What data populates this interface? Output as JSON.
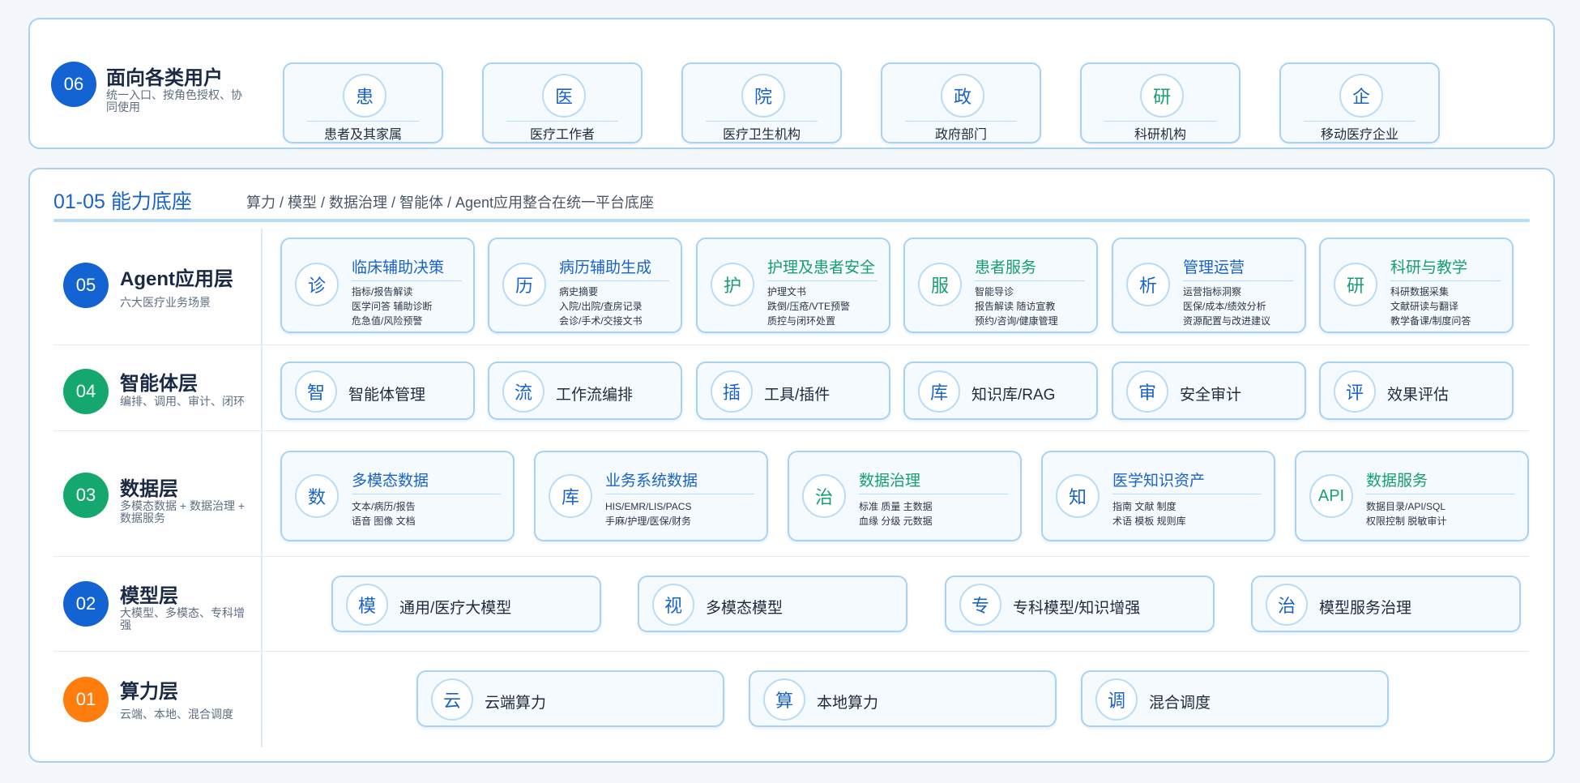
{
  "colors": {
    "blue_badge": "#1463d2",
    "green_badge": "#14a86e",
    "orange_badge": "#ff7d0d",
    "accent": "#1a63c8",
    "accent_green": "#16a070"
  },
  "users": {
    "badge": "06",
    "title": "面向各类用户",
    "subtitle": "统一入口、按角色授权、协同使用",
    "items": [
      {
        "icon": "患",
        "label": "患者及其家属",
        "tone": "blue"
      },
      {
        "icon": "医",
        "label": "医疗工作者",
        "tone": "blue"
      },
      {
        "icon": "院",
        "label": "医疗卫生机构",
        "tone": "blue"
      },
      {
        "icon": "政",
        "label": "政府部门",
        "tone": "blue"
      },
      {
        "icon": "研",
        "label": "科研机构",
        "tone": "green"
      },
      {
        "icon": "企",
        "label": "移动医疗企业",
        "tone": "blue"
      }
    ]
  },
  "platform": {
    "title": "01-05 能力底座",
    "subtitle": "算力 / 模型 / 数据治理 / 智能体 / Agent应用整合在统一平台底座"
  },
  "layers": {
    "l05": {
      "badge": "05",
      "title": "Agent应用层",
      "subtitle": "六大医疗业务场景",
      "cards": [
        {
          "icon": "诊",
          "title": "临床辅助决策",
          "tone": "blue",
          "lines": [
            "指标/报告解读",
            "医学问答 辅助诊断",
            "危急值/风险预警"
          ]
        },
        {
          "icon": "历",
          "title": "病历辅助生成",
          "tone": "blue",
          "lines": [
            "病史摘要",
            "入院/出院/查房记录",
            "会诊/手术/交接文书"
          ]
        },
        {
          "icon": "护",
          "title": "护理及患者安全",
          "tone": "green",
          "lines": [
            "护理文书",
            "跌倒/压疮/VTE预警",
            "质控与闭环处置"
          ]
        },
        {
          "icon": "服",
          "title": "患者服务",
          "tone": "green",
          "lines": [
            "智能导诊",
            "报告解读 随访宣教",
            "预约/咨询/健康管理"
          ]
        },
        {
          "icon": "析",
          "title": "管理运营",
          "tone": "blue",
          "lines": [
            "运营指标洞察",
            "医保/成本/绩效分析",
            "资源配置与改进建议"
          ]
        },
        {
          "icon": "研",
          "title": "科研与教学",
          "tone": "green",
          "lines": [
            "科研数据采集",
            "文献研读与翻译",
            "教学备课/制度问答"
          ]
        }
      ]
    },
    "l04": {
      "badge": "04",
      "title": "智能体层",
      "subtitle": "编排、调用、审计、闭环",
      "cards": [
        {
          "icon": "智",
          "label": "智能体管理"
        },
        {
          "icon": "流",
          "label": "工作流编排"
        },
        {
          "icon": "插",
          "label": "工具/插件"
        },
        {
          "icon": "库",
          "label": "知识库/RAG"
        },
        {
          "icon": "审",
          "label": "安全审计"
        },
        {
          "icon": "评",
          "label": "效果评估"
        }
      ]
    },
    "l03": {
      "badge": "03",
      "title": "数据层",
      "subtitle": "多模态数据 + 数据治理 + 数据服务",
      "cards": [
        {
          "icon": "数",
          "title": "多模态数据",
          "tone": "blue",
          "lines": [
            "文本/病历/报告",
            "语音 图像 文档"
          ]
        },
        {
          "icon": "库",
          "title": "业务系统数据",
          "tone": "blue",
          "lines": [
            "HIS/EMR/LIS/PACS",
            "手麻/护理/医保/财务"
          ]
        },
        {
          "icon": "治",
          "title": "数据治理",
          "tone": "green",
          "lines": [
            "标准 质量 主数据",
            "血缘 分级 元数据"
          ]
        },
        {
          "icon": "知",
          "title": "医学知识资产",
          "tone": "blue",
          "lines": [
            "指南 文献 制度",
            "术语 模板 规则库"
          ]
        },
        {
          "icon": "API",
          "title": "数据服务",
          "tone": "green",
          "lines": [
            "数据目录/API/SQL",
            "权限控制 脱敏审计"
          ]
        }
      ]
    },
    "l02": {
      "badge": "02",
      "title": "模型层",
      "subtitle": "大模型、多模态、专科增强",
      "cards": [
        {
          "icon": "模",
          "label": "通用/医疗大模型"
        },
        {
          "icon": "视",
          "label": "多模态模型"
        },
        {
          "icon": "专",
          "label": "专科模型/知识增强"
        },
        {
          "icon": "治",
          "label": "模型服务治理"
        }
      ]
    },
    "l01": {
      "badge": "01",
      "title": "算力层",
      "subtitle": "云端、本地、混合调度",
      "cards": [
        {
          "icon": "云",
          "label": "云端算力"
        },
        {
          "icon": "算",
          "label": "本地算力"
        },
        {
          "icon": "调",
          "label": "混合调度"
        }
      ]
    }
  }
}
